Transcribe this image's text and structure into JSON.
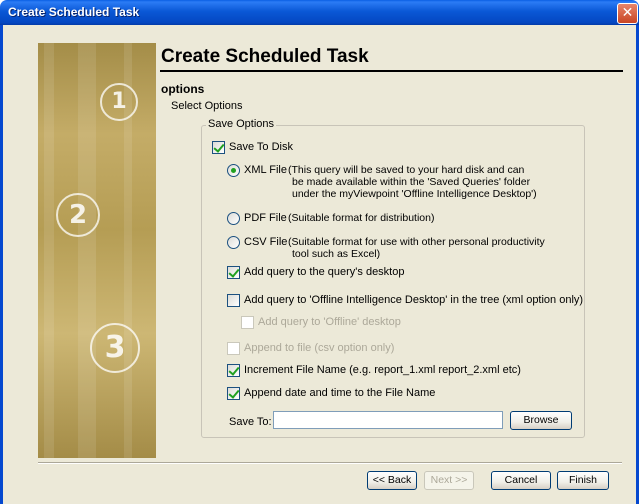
{
  "window": {
    "title": "Create Scheduled Task",
    "close_glyph": "✕"
  },
  "header": {
    "title": "Create Scheduled Task",
    "section": "options",
    "subtitle": "Select Options"
  },
  "art": {
    "steps": [
      "1",
      "2",
      "3"
    ]
  },
  "save_options": {
    "group_label": "Save Options",
    "save_to_disk": {
      "label": "Save To Disk",
      "checked": true
    },
    "xml_file": {
      "label": "XML File",
      "selected": true,
      "description": [
        "(This query will be saved to your hard disk and can",
        "be made available within the 'Saved Queries' folder",
        "under the myViewpoint 'Offline Intelligence Desktop')"
      ]
    },
    "pdf_file": {
      "label": "PDF File",
      "selected": false,
      "description": [
        "(Suitable format for distribution)"
      ]
    },
    "csv_file": {
      "label": "CSV File",
      "selected": false,
      "description": [
        "(Suitable format for use with other personal productivity",
        "tool such as Excel)"
      ]
    },
    "add_to_query_desktop": {
      "label": "Add query to the query's desktop",
      "checked": true
    },
    "add_to_offline_tree": {
      "label": "Add query to 'Offline Intelligence Desktop' in the tree (xml option only)",
      "checked": false
    },
    "add_to_offline_desktop": {
      "label": "Add query to 'Offline' desktop",
      "checked": false,
      "enabled": false
    },
    "append_to_file": {
      "label": "Append to file (csv option only)",
      "checked": false,
      "enabled": false
    },
    "increment_file_name": {
      "label": "Increment File Name (e.g. report_1.xml report_2.xml etc)",
      "checked": true
    },
    "append_date_time": {
      "label": "Append date and time to the File Name",
      "checked": true
    },
    "save_to": {
      "label": "Save To:",
      "value": "",
      "browse_label": "Browse"
    }
  },
  "footer": {
    "back_label": "<< Back",
    "next_label": "Next >>",
    "cancel_label": "Cancel",
    "finish_label": "Finish"
  },
  "colors": {
    "titlebar": "#0a58d6",
    "dialog_bg": "#ece9d8",
    "check_mark": "#21a121",
    "art_gold": "#b59d54"
  }
}
